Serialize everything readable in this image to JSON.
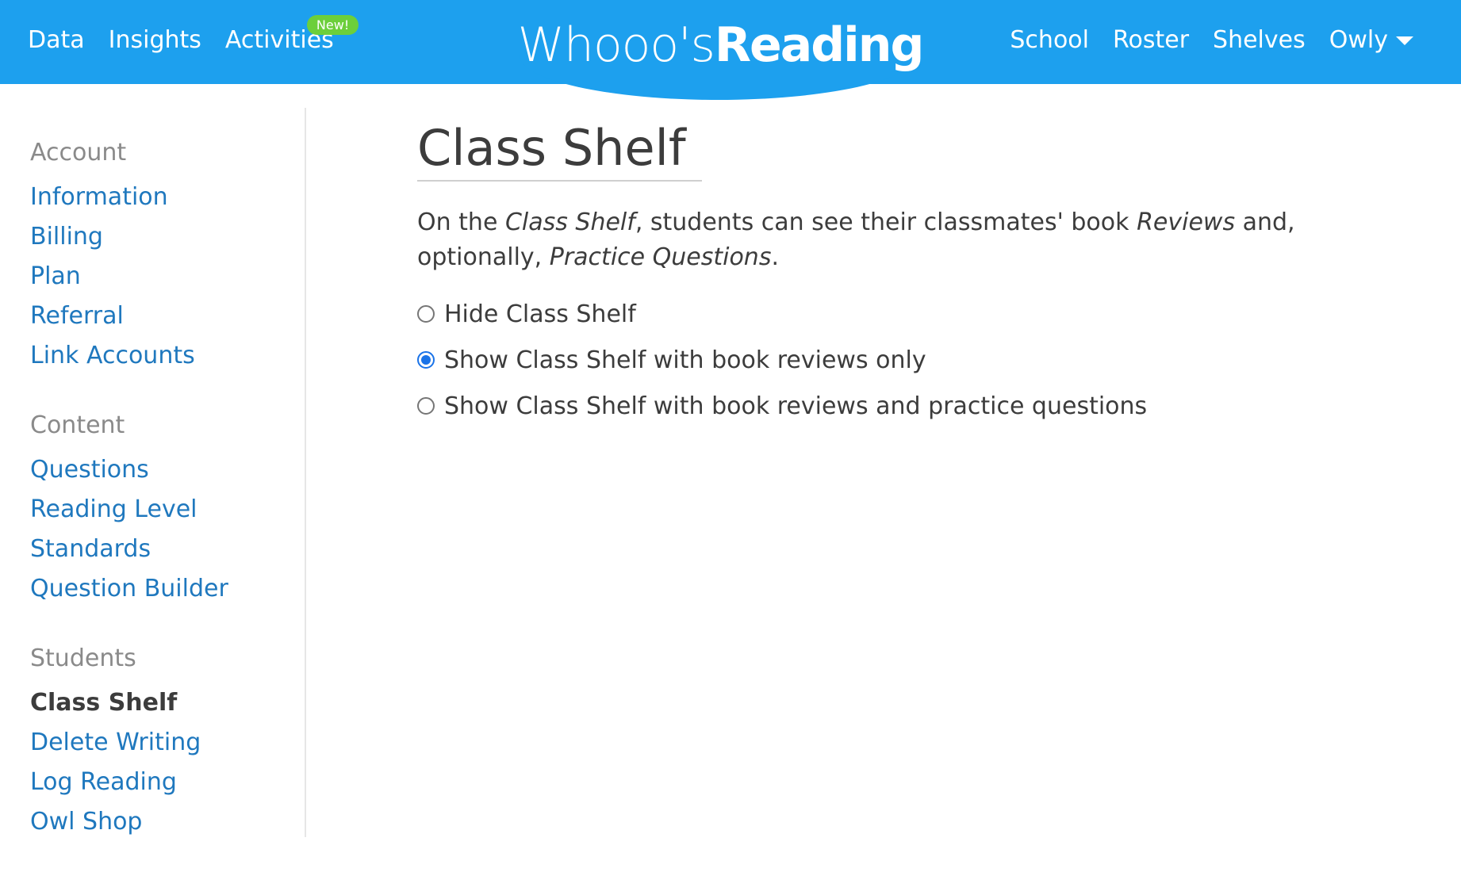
{
  "topnav": {
    "left": [
      {
        "label": "Data"
      },
      {
        "label": "Insights"
      },
      {
        "label": "Activities",
        "badge": "New!"
      }
    ],
    "logo": {
      "part1": "Whooo's",
      "part2": "Reading"
    },
    "right": [
      {
        "label": "School"
      },
      {
        "label": "Roster"
      },
      {
        "label": "Shelves"
      },
      {
        "label": "Owly",
        "icon": "caret-down-icon"
      }
    ]
  },
  "sidebar": {
    "sections": [
      {
        "heading": "Account",
        "items": [
          "Information",
          "Billing",
          "Plan",
          "Referral",
          "Link Accounts"
        ]
      },
      {
        "heading": "Content",
        "items": [
          "Questions",
          "Reading Level",
          "Standards",
          "Question Builder"
        ]
      },
      {
        "heading": "Students",
        "items": [
          "Class Shelf",
          "Delete Writing",
          "Log Reading",
          "Owl Shop"
        ],
        "active": "Class Shelf"
      }
    ]
  },
  "main": {
    "title": "Class Shelf",
    "description": {
      "t1": "On the ",
      "em1": "Class Shelf",
      "t2": ", students can see their classmates' book ",
      "em2": "Reviews",
      "t3": " and, optionally, ",
      "em3": "Practice Questions",
      "t4": "."
    },
    "options": [
      {
        "label": "Hide Class Shelf",
        "checked": false
      },
      {
        "label": "Show Class Shelf with book reviews only",
        "checked": true
      },
      {
        "label": "Show Class Shelf with book reviews and practice questions",
        "checked": false
      }
    ]
  },
  "colors": {
    "brand": "#1da0ee",
    "link": "#1f78be",
    "badge": "#6ccf3b",
    "radio": "#1a73e8"
  }
}
